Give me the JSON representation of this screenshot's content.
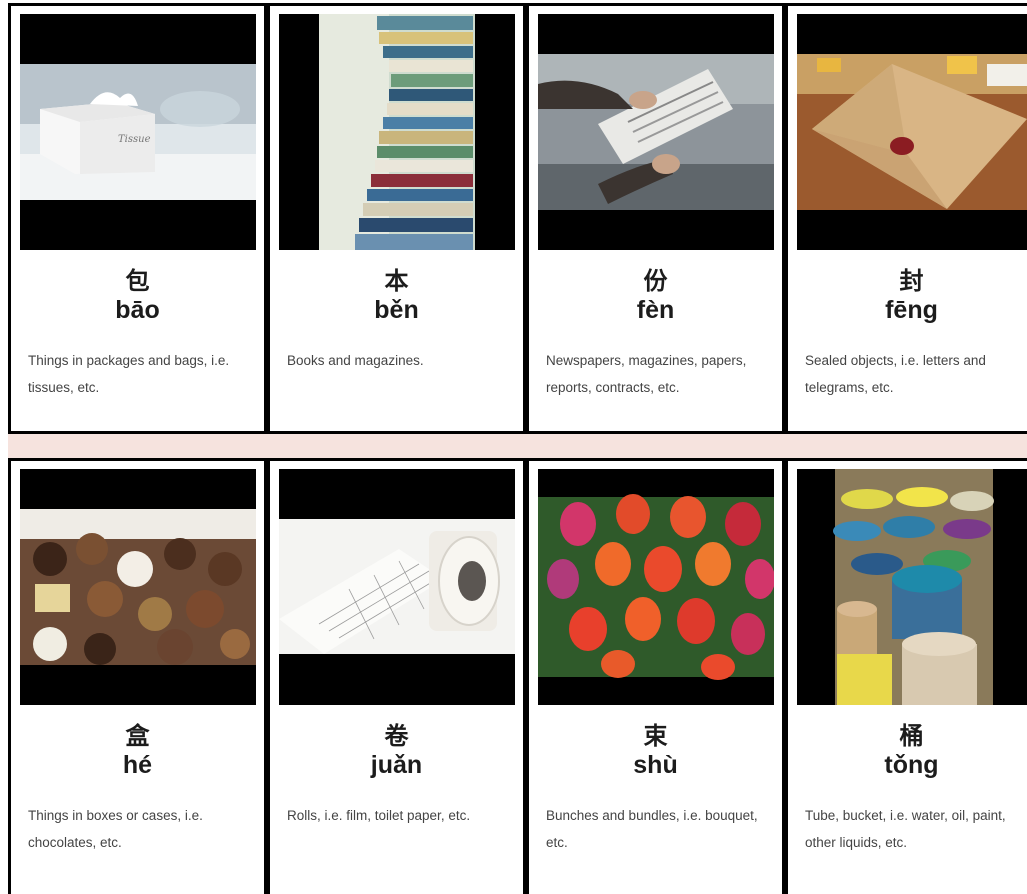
{
  "cards": [
    {
      "hanzi": "包",
      "pinyin": "bāo",
      "desc": "Things in packages and bags, i.e. tissues, etc.",
      "image": "tissue-box-photo"
    },
    {
      "hanzi": "本",
      "pinyin": "běn",
      "desc": "Books and magazines.",
      "image": "book-stack-photo"
    },
    {
      "hanzi": "份",
      "pinyin": "fèn",
      "desc": "Newspapers, magazines, papers, reports, contracts, etc.",
      "image": "newspaper-photo"
    },
    {
      "hanzi": "封",
      "pinyin": "fēng",
      "desc": "Sealed objects, i.e. letters and telegrams, etc.",
      "image": "sealed-envelope-photo"
    },
    {
      "hanzi": "盒",
      "pinyin": "hé",
      "desc": "Things in boxes or cases, i.e. chocolates, etc.",
      "image": "chocolate-box-photo"
    },
    {
      "hanzi": "卷",
      "pinyin": "juǎn",
      "desc": "Rolls, i.e. film, toilet paper, etc.",
      "image": "toilet-paper-roll-photo"
    },
    {
      "hanzi": "束",
      "pinyin": "shù",
      "desc": "Bunches and bundles, i.e. bouquet, etc.",
      "image": "tulip-bouquet-photo"
    },
    {
      "hanzi": "桶",
      "pinyin": "tǒng",
      "desc": "Tube, bucket, i.e. water, oil, paint, other liquids, etc.",
      "image": "paint-buckets-photo"
    }
  ]
}
